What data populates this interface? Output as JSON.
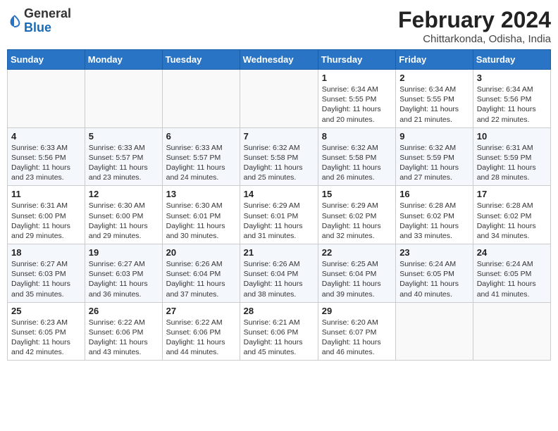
{
  "logo": {
    "general": "General",
    "blue": "Blue"
  },
  "title": "February 2024",
  "location": "Chittarkonda, Odisha, India",
  "days_header": [
    "Sunday",
    "Monday",
    "Tuesday",
    "Wednesday",
    "Thursday",
    "Friday",
    "Saturday"
  ],
  "weeks": [
    [
      {
        "day": "",
        "info": ""
      },
      {
        "day": "",
        "info": ""
      },
      {
        "day": "",
        "info": ""
      },
      {
        "day": "",
        "info": ""
      },
      {
        "day": "1",
        "info": "Sunrise: 6:34 AM\nSunset: 5:55 PM\nDaylight: 11 hours and 20 minutes."
      },
      {
        "day": "2",
        "info": "Sunrise: 6:34 AM\nSunset: 5:55 PM\nDaylight: 11 hours and 21 minutes."
      },
      {
        "day": "3",
        "info": "Sunrise: 6:34 AM\nSunset: 5:56 PM\nDaylight: 11 hours and 22 minutes."
      }
    ],
    [
      {
        "day": "4",
        "info": "Sunrise: 6:33 AM\nSunset: 5:56 PM\nDaylight: 11 hours and 23 minutes."
      },
      {
        "day": "5",
        "info": "Sunrise: 6:33 AM\nSunset: 5:57 PM\nDaylight: 11 hours and 23 minutes."
      },
      {
        "day": "6",
        "info": "Sunrise: 6:33 AM\nSunset: 5:57 PM\nDaylight: 11 hours and 24 minutes."
      },
      {
        "day": "7",
        "info": "Sunrise: 6:32 AM\nSunset: 5:58 PM\nDaylight: 11 hours and 25 minutes."
      },
      {
        "day": "8",
        "info": "Sunrise: 6:32 AM\nSunset: 5:58 PM\nDaylight: 11 hours and 26 minutes."
      },
      {
        "day": "9",
        "info": "Sunrise: 6:32 AM\nSunset: 5:59 PM\nDaylight: 11 hours and 27 minutes."
      },
      {
        "day": "10",
        "info": "Sunrise: 6:31 AM\nSunset: 5:59 PM\nDaylight: 11 hours and 28 minutes."
      }
    ],
    [
      {
        "day": "11",
        "info": "Sunrise: 6:31 AM\nSunset: 6:00 PM\nDaylight: 11 hours and 29 minutes."
      },
      {
        "day": "12",
        "info": "Sunrise: 6:30 AM\nSunset: 6:00 PM\nDaylight: 11 hours and 29 minutes."
      },
      {
        "day": "13",
        "info": "Sunrise: 6:30 AM\nSunset: 6:01 PM\nDaylight: 11 hours and 30 minutes."
      },
      {
        "day": "14",
        "info": "Sunrise: 6:29 AM\nSunset: 6:01 PM\nDaylight: 11 hours and 31 minutes."
      },
      {
        "day": "15",
        "info": "Sunrise: 6:29 AM\nSunset: 6:02 PM\nDaylight: 11 hours and 32 minutes."
      },
      {
        "day": "16",
        "info": "Sunrise: 6:28 AM\nSunset: 6:02 PM\nDaylight: 11 hours and 33 minutes."
      },
      {
        "day": "17",
        "info": "Sunrise: 6:28 AM\nSunset: 6:02 PM\nDaylight: 11 hours and 34 minutes."
      }
    ],
    [
      {
        "day": "18",
        "info": "Sunrise: 6:27 AM\nSunset: 6:03 PM\nDaylight: 11 hours and 35 minutes."
      },
      {
        "day": "19",
        "info": "Sunrise: 6:27 AM\nSunset: 6:03 PM\nDaylight: 11 hours and 36 minutes."
      },
      {
        "day": "20",
        "info": "Sunrise: 6:26 AM\nSunset: 6:04 PM\nDaylight: 11 hours and 37 minutes."
      },
      {
        "day": "21",
        "info": "Sunrise: 6:26 AM\nSunset: 6:04 PM\nDaylight: 11 hours and 38 minutes."
      },
      {
        "day": "22",
        "info": "Sunrise: 6:25 AM\nSunset: 6:04 PM\nDaylight: 11 hours and 39 minutes."
      },
      {
        "day": "23",
        "info": "Sunrise: 6:24 AM\nSunset: 6:05 PM\nDaylight: 11 hours and 40 minutes."
      },
      {
        "day": "24",
        "info": "Sunrise: 6:24 AM\nSunset: 6:05 PM\nDaylight: 11 hours and 41 minutes."
      }
    ],
    [
      {
        "day": "25",
        "info": "Sunrise: 6:23 AM\nSunset: 6:05 PM\nDaylight: 11 hours and 42 minutes."
      },
      {
        "day": "26",
        "info": "Sunrise: 6:22 AM\nSunset: 6:06 PM\nDaylight: 11 hours and 43 minutes."
      },
      {
        "day": "27",
        "info": "Sunrise: 6:22 AM\nSunset: 6:06 PM\nDaylight: 11 hours and 44 minutes."
      },
      {
        "day": "28",
        "info": "Sunrise: 6:21 AM\nSunset: 6:06 PM\nDaylight: 11 hours and 45 minutes."
      },
      {
        "day": "29",
        "info": "Sunrise: 6:20 AM\nSunset: 6:07 PM\nDaylight: 11 hours and 46 minutes."
      },
      {
        "day": "",
        "info": ""
      },
      {
        "day": "",
        "info": ""
      }
    ]
  ]
}
